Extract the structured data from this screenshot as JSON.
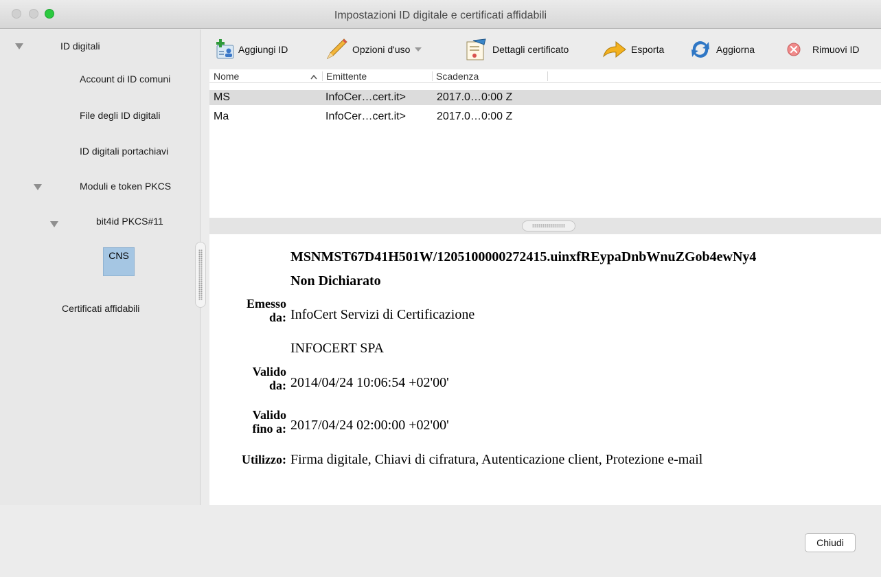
{
  "window": {
    "title": "Impostazioni ID digitale e certificati affidabili"
  },
  "sidebar": {
    "items": [
      {
        "label": "ID digitali"
      },
      {
        "label": "Account di ID comuni"
      },
      {
        "label": "File degli ID digitali"
      },
      {
        "label": "ID digitali portachiavi"
      },
      {
        "label": "Moduli e token PKCS"
      },
      {
        "label": "bit4id PKCS#11"
      },
      {
        "label": "CNS"
      },
      {
        "label": "Certificati affidabili"
      }
    ]
  },
  "toolbar": {
    "add_label": "Aggiungi ID",
    "usage_label": "Opzioni d'uso",
    "details_label": "Dettagli certificato",
    "export_label": "Esporta",
    "refresh_label": "Aggiorna",
    "remove_label": "Rimuovi ID"
  },
  "list": {
    "columns": [
      "Nome",
      "Emittente",
      "Scadenza"
    ],
    "rows": [
      {
        "name": "MS",
        "issuer": "InfoCer…cert.it>",
        "expiry": "2017.0…0:00 Z"
      },
      {
        "name": "Ma",
        "issuer": "InfoCer…cert.it>",
        "expiry": "2017.0…0:00 Z"
      }
    ]
  },
  "detail": {
    "title": "MSNMST67D41H501W/1205100000272415.uinxfREypaDnbWnuZGob4ewNy4",
    "subtitle": "Non Dichiarato",
    "issued_by_label_1": "Emesso",
    "issued_by_label_2": "da:",
    "issued_by_value": "InfoCert Servizi di Certificazione",
    "issued_by_org": "INFOCERT SPA",
    "valid_from_label_1": "Valido",
    "valid_from_label_2": "da:",
    "valid_from_value": "2014/04/24 10:06:54 +02'00'",
    "valid_to_label_1": "Valido",
    "valid_to_label_2": "fino a:",
    "valid_to_value": "2017/04/24 02:00:00 +02'00'",
    "usage_label": "Utilizzo:",
    "usage_value": "Firma digitale, Chiavi di cifratura, Autenticazione client, Protezione e-mail"
  },
  "footer": {
    "close_label": "Chiudi"
  }
}
